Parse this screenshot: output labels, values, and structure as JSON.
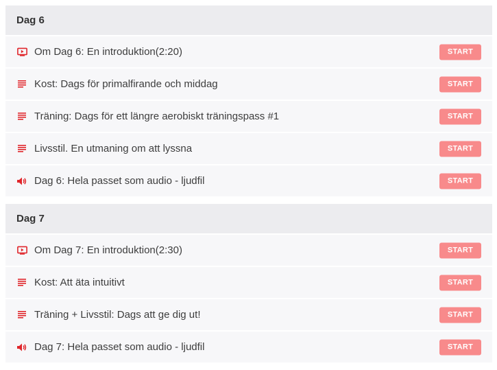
{
  "accent_color": "#e0262b",
  "button_color": "#f88a8b",
  "sections": [
    {
      "title": "Dag 6",
      "lessons": [
        {
          "icon": "video-icon",
          "title": "Om Dag 6: En introduktion(2:20)",
          "button": "START"
        },
        {
          "icon": "text-icon",
          "title": "Kost: Dags för primalfirande och middag",
          "button": "START"
        },
        {
          "icon": "text-icon",
          "title": "Träning: Dags för ett längre aerobiskt träningspass #1",
          "button": "START"
        },
        {
          "icon": "text-icon",
          "title": "Livsstil. En utmaning om att lyssna",
          "button": "START"
        },
        {
          "icon": "audio-icon",
          "title": "Dag 6: Hela passet som audio - ljudfil",
          "button": "START"
        }
      ]
    },
    {
      "title": "Dag 7",
      "lessons": [
        {
          "icon": "video-icon",
          "title": "Om Dag 7: En introduktion(2:30)",
          "button": "START"
        },
        {
          "icon": "text-icon",
          "title": "Kost: Att äta intuitivt",
          "button": "START"
        },
        {
          "icon": "text-icon",
          "title": "Träning + Livsstil: Dags att ge dig ut!",
          "button": "START"
        },
        {
          "icon": "audio-icon",
          "title": "Dag 7: Hela passet som audio - ljudfil",
          "button": "START"
        }
      ]
    }
  ]
}
